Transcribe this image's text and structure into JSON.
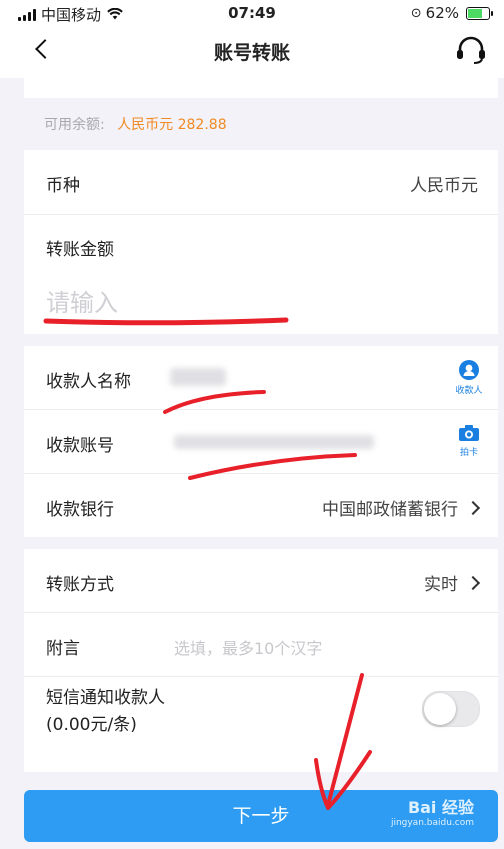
{
  "status_bar": {
    "carrier": "中国移动",
    "time": "07:49",
    "battery_percent": "62%"
  },
  "nav": {
    "title": "账号转账"
  },
  "balance": {
    "label": "可用余额:",
    "value": "人民币元 282.88"
  },
  "currency": {
    "label": "币种",
    "value": "人民币元"
  },
  "amount": {
    "label": "转账金额",
    "placeholder": "请输入"
  },
  "payee": {
    "name_label": "收款人名称",
    "payee_icon_label": "收款人",
    "account_label": "收款账号",
    "card_icon_label": "拍卡",
    "bank_label": "收款银行",
    "bank_value": "中国邮政储蓄银行"
  },
  "transfer": {
    "method_label": "转账方式",
    "method_value": "实时",
    "note_label": "附言",
    "note_placeholder": "选填，最多10个汉字",
    "sms_label_line1": "短信通知收款人",
    "sms_label_line2": "(0.00元/条)",
    "sms_enabled": false
  },
  "next_button": {
    "label": "下一步"
  },
  "watermark": {
    "logo": "Bai 经验",
    "url": "jingyan.baidu.com"
  },
  "colors": {
    "accent": "#2d9cf2",
    "balance": "#f08a24",
    "annotation": "#e8202a"
  },
  "icons": [
    "back-icon",
    "headset-icon",
    "payee-icon",
    "camera-icon",
    "chevron-right-icon",
    "wifi-icon"
  ]
}
